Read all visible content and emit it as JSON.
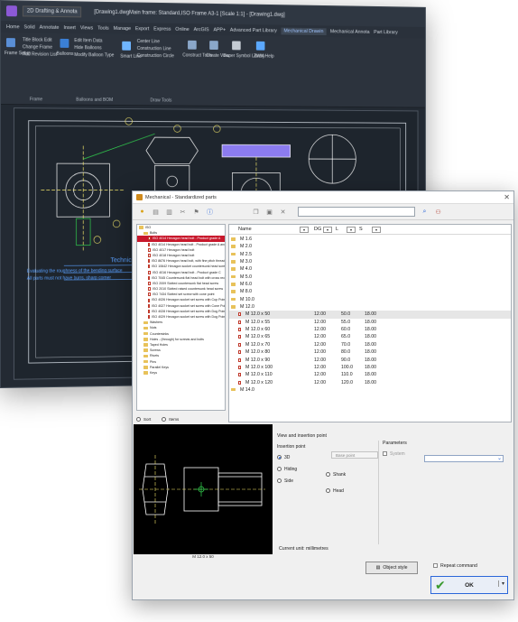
{
  "cad": {
    "tabs_top": [
      "2D Drafting & Annota"
    ],
    "document_title": "[Drawing1.dwgMain frame: Standard,ISO Frame A3-1 [Scale 1:1] - [Drawing1.dwg]",
    "tabs": [
      "Home",
      "Solid",
      "Annotate",
      "Insert",
      "Views",
      "Tools",
      "Manage",
      "Export",
      "Express",
      "Online",
      "ArcGIS",
      "APP+",
      "Advanced Part Library",
      "Mechanical Drawin",
      "Mechanical Annota",
      "Part Library"
    ],
    "active_tab": "Mechanical Drawin",
    "ribbon": {
      "frame_setup": "Frame Setup",
      "title_block_edit": "Title Block Edit",
      "change_frame": "Change Frame",
      "add_revision": "Add Revision List",
      "frame_group": "Frame",
      "balloons": "Balloons",
      "edit_item_data": "Edit Item Data",
      "hide_balloons": "Hide Balloons",
      "modify_balloon_type": "Modify Balloon Type",
      "balloons_group": "Balloons and BOM",
      "center_line": "Center Line",
      "construction_line": "Construction Line",
      "construction_circle": "Construction Circle",
      "smart_line": "Smart Line",
      "draw_tools_group": "Draw Tools",
      "construct_tools": "Construct Tools",
      "create_view": "Create View",
      "super_symbol_library": "Super Symbol Library",
      "zwm_help": "ZWM Help"
    },
    "drawing_note": "Technical",
    "note_lines": [
      "Evaluating the roughness of the bending surface",
      "All parts must not have burrs, sharp corner",
      "..."
    ]
  },
  "dialog": {
    "title": "Mechanical - Standardized parts",
    "search": {
      "value": ""
    },
    "tree": [
      {
        "label": "ISO",
        "type": "folder",
        "indent": 0
      },
      {
        "label": "Bolts",
        "type": "folder",
        "indent": 1
      },
      {
        "label": "ISO 4014 Hexagon head bolt - Product grade A",
        "type": "item",
        "indent": 2,
        "selected": true
      },
      {
        "label": "ISO 4014 Hexagon head bolt - Product grade A and B",
        "type": "item",
        "indent": 2
      },
      {
        "label": "ISO 4017 Hexagon head bolt",
        "type": "item",
        "indent": 2
      },
      {
        "label": "ISO 4018 Hexagon head bolt",
        "type": "item",
        "indent": 2
      },
      {
        "label": "ISO 8676 Hexagon head bolt, with fine pitch thread",
        "type": "item",
        "indent": 2
      },
      {
        "label": "ISO 10642 Hexagon socket countersunk head screw",
        "type": "item",
        "indent": 2
      },
      {
        "label": "ISO 4016 Hexagon head bolt - Product grade C",
        "type": "item",
        "indent": 2
      },
      {
        "label": "ISO 7045 Countersunk flat head bolt with cross recess",
        "type": "item",
        "indent": 2
      },
      {
        "label": "ISO 2009 Slotted countersunk flat head screw",
        "type": "item",
        "indent": 2
      },
      {
        "label": "ISO 2010 Slotted raised countersunk head screw",
        "type": "item",
        "indent": 2
      },
      {
        "label": "ISO 7434 Slotted set screw with cone point",
        "type": "item",
        "indent": 2
      },
      {
        "label": "ISO 4026 Hexagon socket set screw with Cup Point",
        "type": "item",
        "indent": 2
      },
      {
        "label": "ISO 4027 Hexagon socket set screw with Cone Point",
        "type": "item",
        "indent": 2
      },
      {
        "label": "ISO 4028 Hexagon socket set screw with Dog Point",
        "type": "item",
        "indent": 2
      },
      {
        "label": "ISO 4029 Hexagon socket set screw with Dog Point",
        "type": "item",
        "indent": 2
      },
      {
        "label": "Washers",
        "type": "folder",
        "indent": 1
      },
      {
        "label": "Nuts",
        "type": "folder",
        "indent": 1
      },
      {
        "label": "Countersinks",
        "type": "folder",
        "indent": 1
      },
      {
        "label": "Holes - (through) for screws and bolts",
        "type": "folder",
        "indent": 1
      },
      {
        "label": "Taped Holes",
        "type": "folder",
        "indent": 1
      },
      {
        "label": "Screws",
        "type": "folder",
        "indent": 1
      },
      {
        "label": "Rivets",
        "type": "folder",
        "indent": 1
      },
      {
        "label": "Pins",
        "type": "folder",
        "indent": 1
      },
      {
        "label": "Parallel Keys",
        "type": "folder",
        "indent": 1
      },
      {
        "label": "Keys",
        "type": "folder",
        "indent": 1
      }
    ],
    "grid": {
      "columns": [
        "Name",
        "DG",
        "L",
        "S"
      ],
      "rows": [
        {
          "name": "M 1.6",
          "type": "folder"
        },
        {
          "name": "M 2.0",
          "type": "folder"
        },
        {
          "name": "M 2.5",
          "type": "folder"
        },
        {
          "name": "M 3.0",
          "type": "folder"
        },
        {
          "name": "M 4.0",
          "type": "folder"
        },
        {
          "name": "M 5.0",
          "type": "folder"
        },
        {
          "name": "M 6.0",
          "type": "folder"
        },
        {
          "name": "M 8.0",
          "type": "folder"
        },
        {
          "name": "M 10.0",
          "type": "folder"
        },
        {
          "name": "M 12.0",
          "type": "folder"
        },
        {
          "name": "M 12.0 x 50",
          "type": "item",
          "dg": "12.00",
          "l": "50.0",
          "s": "18.00",
          "selected": true
        },
        {
          "name": "M 12.0 x 55",
          "type": "item",
          "dg": "12.00",
          "l": "55.0",
          "s": "18.00"
        },
        {
          "name": "M 12.0 x 60",
          "type": "item",
          "dg": "12.00",
          "l": "60.0",
          "s": "18.00"
        },
        {
          "name": "M 12.0 x 65",
          "type": "item",
          "dg": "12.00",
          "l": "65.0",
          "s": "18.00"
        },
        {
          "name": "M 12.0 x 70",
          "type": "item",
          "dg": "12.00",
          "l": "70.0",
          "s": "18.00"
        },
        {
          "name": "M 12.0 x 80",
          "type": "item",
          "dg": "12.00",
          "l": "80.0",
          "s": "18.00"
        },
        {
          "name": "M 12.0 x 90",
          "type": "item",
          "dg": "12.00",
          "l": "90.0",
          "s": "18.00"
        },
        {
          "name": "M 12.0 x 100",
          "type": "item",
          "dg": "12.00",
          "l": "100.0",
          "s": "18.00"
        },
        {
          "name": "M 12.0 x 110",
          "type": "item",
          "dg": "12.00",
          "l": "110.0",
          "s": "18.00"
        },
        {
          "name": "M 12.0 x 120",
          "type": "item",
          "dg": "12.00",
          "l": "120.0",
          "s": "18.00"
        },
        {
          "name": "M 14.0",
          "type": "folder"
        }
      ]
    },
    "sort_label": "Sort",
    "items_label": "Items",
    "preview_caption": "M 12.0 x 50",
    "view_insertion": "View and insertion point",
    "insertion_point": "Insertion point",
    "base_point": "Base point",
    "radios": {
      "r3d": "3D",
      "hiding": "Hiding",
      "side": "Side",
      "shank": "Shank",
      "head": "Head"
    },
    "parameters": "Parameters",
    "system": "System",
    "current_unit": "Current unit: millimetres",
    "object_style": "Object style",
    "repeat_command": "Repeat command",
    "ok": "OK"
  },
  "colors": {
    "cad_background": "#232a33",
    "selection_red": "#c8182c",
    "accent_blue": "#2b66d9",
    "ok_check_green": "#3a9a2f"
  }
}
